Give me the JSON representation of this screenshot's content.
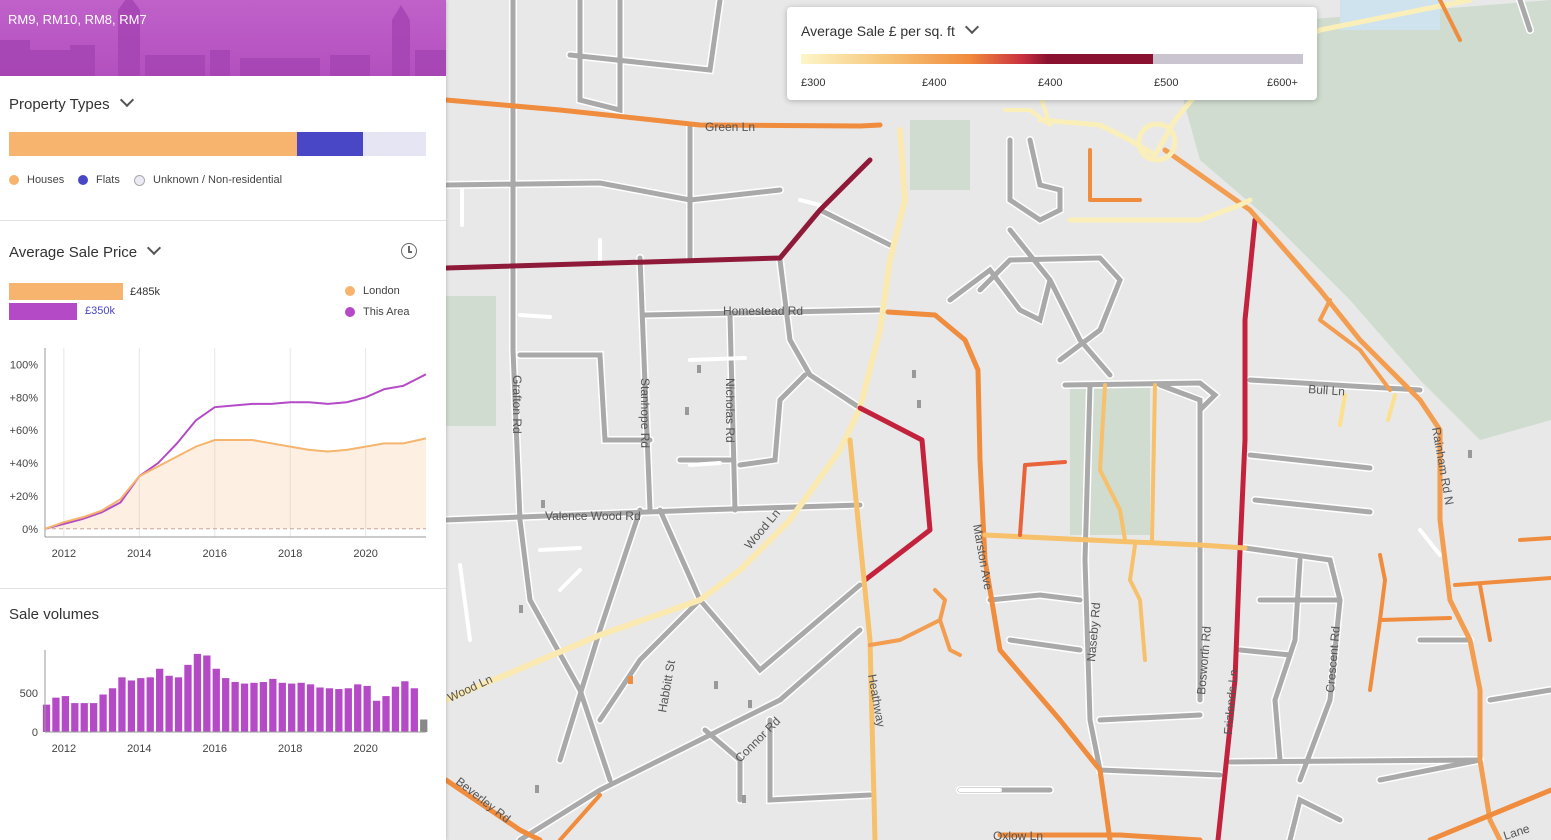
{
  "area_title": "RM9, RM10, RM8, RM7",
  "property_types": {
    "title": "Property Types",
    "segments": [
      {
        "name": "Houses",
        "fraction": 0.69,
        "color": "#f6b46e"
      },
      {
        "name": "Flats",
        "fraction": 0.16,
        "color": "#4a47c6"
      },
      {
        "name": "Unknown / Non-residential",
        "fraction": 0.15,
        "color": "#e6e5f3"
      }
    ]
  },
  "avg_price": {
    "title": "Average Sale Price",
    "london_label": "London",
    "area_label": "This Area",
    "london_value": "£485k",
    "area_value": "£350k",
    "london_color": "#f6b46e",
    "area_color": "#b44ac6"
  },
  "sale_volumes": {
    "title": "Sale volumes"
  },
  "chart_data": [
    {
      "type": "line",
      "title": "Average Sale Price",
      "xlim": [
        2011.5,
        2021.6
      ],
      "ylim": [
        -5,
        110
      ],
      "yticks": [
        "100%",
        "+80%",
        "+60%",
        "+40%",
        "+20%",
        "0%"
      ],
      "ytick_values": [
        100,
        80,
        60,
        40,
        20,
        0
      ],
      "xticks": [
        "2012",
        "2014",
        "2016",
        "2018",
        "2020"
      ],
      "xtick_values": [
        2012,
        2014,
        2016,
        2018,
        2020
      ],
      "series": [
        {
          "name": "London",
          "color": "#f6b46e",
          "x": [
            2011.5,
            2012,
            2012.5,
            2013,
            2013.5,
            2014,
            2014.5,
            2015,
            2015.5,
            2016,
            2016.5,
            2017,
            2017.5,
            2018,
            2018.5,
            2019,
            2019.5,
            2020,
            2020.5,
            2021,
            2021.6
          ],
          "y": [
            0,
            4,
            7,
            11,
            18,
            32,
            38,
            44,
            50,
            54,
            54,
            54,
            52,
            50,
            48,
            47,
            48,
            50,
            52,
            52,
            55
          ]
        },
        {
          "name": "This Area",
          "color": "#b44ac6",
          "x": [
            2011.5,
            2012,
            2012.5,
            2013,
            2013.5,
            2014,
            2014.5,
            2015,
            2015.5,
            2016,
            2016.5,
            2017,
            2017.5,
            2018,
            2018.5,
            2019,
            2019.5,
            2020,
            2020.5,
            2021,
            2021.6
          ],
          "y": [
            0,
            3,
            6,
            10,
            16,
            32,
            40,
            52,
            66,
            74,
            75,
            76,
            76,
            77,
            77,
            76,
            77,
            80,
            85,
            87,
            94
          ]
        }
      ]
    },
    {
      "type": "bar",
      "title": "Sale volumes",
      "xlim": [
        2011.5,
        2021.6
      ],
      "ylim": [
        0,
        1050
      ],
      "yticks": [
        "500",
        "0"
      ],
      "ytick_values": [
        500,
        0
      ],
      "xticks": [
        "2012",
        "2014",
        "2016",
        "2018",
        "2020"
      ],
      "xtick_values": [
        2012,
        2014,
        2016,
        2018,
        2020
      ],
      "x": [
        2011.54,
        2011.79,
        2012.04,
        2012.29,
        2012.54,
        2012.79,
        2013.04,
        2013.29,
        2013.54,
        2013.79,
        2014.04,
        2014.29,
        2014.54,
        2014.79,
        2015.04,
        2015.29,
        2015.54,
        2015.79,
        2016.04,
        2016.29,
        2016.54,
        2016.79,
        2017.04,
        2017.29,
        2017.54,
        2017.79,
        2018.04,
        2018.29,
        2018.54,
        2018.79,
        2019.04,
        2019.29,
        2019.54,
        2019.79,
        2020.04,
        2020.29,
        2020.54,
        2020.79,
        2021.04,
        2021.29,
        2021.54
      ],
      "values": [
        350,
        440,
        460,
        370,
        370,
        370,
        480,
        560,
        700,
        660,
        690,
        700,
        810,
        720,
        700,
        860,
        1000,
        980,
        810,
        690,
        640,
        620,
        630,
        640,
        680,
        630,
        620,
        630,
        610,
        570,
        560,
        550,
        560,
        610,
        590,
        400,
        460,
        580,
        650,
        560,
        160
      ],
      "colors": [
        "#b44ac6",
        "#888888"
      ]
    }
  ],
  "map": {
    "legend_title": "Average Sale £ per sq. ft",
    "legend_ticks": [
      "£300",
      "£400",
      "£400",
      "£500",
      "£600+"
    ],
    "gradient_colors": [
      "#fdf6c8",
      "#f6c478",
      "#f18a3c",
      "#c9303f",
      "#8a1130"
    ],
    "no_data_color": "#c9c4cf",
    "road_labels": [
      "Green Ln",
      "Homestead Rd",
      "Grafton Rd",
      "Stanhope Rd",
      "Nicholas Rd",
      "Valence Wood Rd",
      "Wood Ln",
      "Wood Ln",
      "Habbitt St",
      "Connor Rd",
      "Heathway",
      "Beverley Rd",
      "Marston Ave",
      "Naseby Rd",
      "Bosworth Rd",
      "Crescent Rd",
      "Bull Ln",
      "Rainham Rd N",
      "Oxlow Ln",
      "Frizlands Ln",
      "Lane"
    ]
  }
}
